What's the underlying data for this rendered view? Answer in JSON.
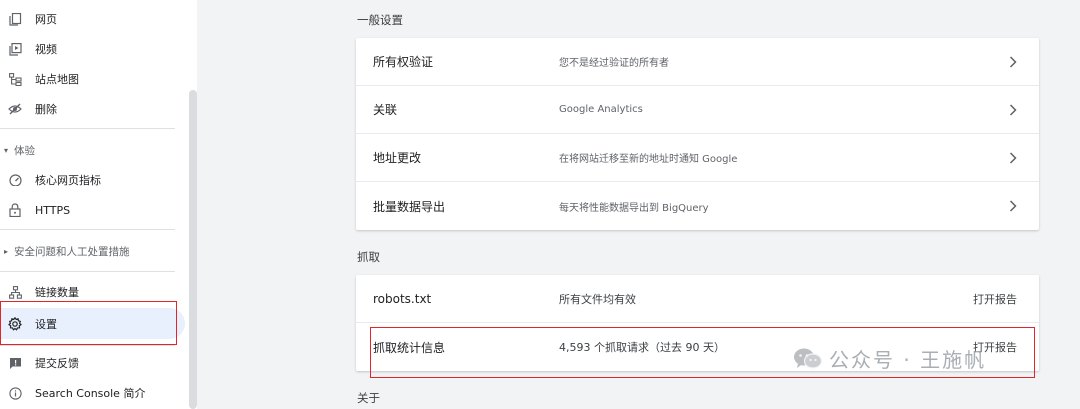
{
  "sidebar": {
    "items_top": [
      {
        "label": "网页",
        "icon": "pages-icon"
      },
      {
        "label": "视频",
        "icon": "video-icon"
      },
      {
        "label": "站点地图",
        "icon": "sitemap-icon"
      },
      {
        "label": "删除",
        "icon": "hidden-eye-icon"
      }
    ],
    "section_experience": "体验",
    "items_experience": [
      {
        "label": "核心网页指标",
        "icon": "speedometer-icon"
      },
      {
        "label": "HTTPS",
        "icon": "lock-icon"
      }
    ],
    "section_security": "安全问题和人工处置措施",
    "items_bottom": [
      {
        "label": "链接数量",
        "icon": "links-icon"
      },
      {
        "label": "设置",
        "icon": "gear-icon"
      }
    ],
    "items_footer": [
      {
        "label": "提交反馈",
        "icon": "feedback-icon"
      },
      {
        "label": "Search Console 简介",
        "icon": "info-icon"
      }
    ]
  },
  "main": {
    "general_heading": "一般设置",
    "general_rows": [
      {
        "title": "所有权验证",
        "desc": "您不是经过验证的所有者"
      },
      {
        "title": "关联",
        "desc": "Google Analytics"
      },
      {
        "title": "地址更改",
        "desc": "在将网站迁移至新的地址时通知 Google"
      },
      {
        "title": "批量数据导出",
        "desc": "每天将性能数据导出到 BigQuery"
      }
    ],
    "crawl_heading": "抓取",
    "crawl_rows": [
      {
        "title": "robots.txt",
        "desc": "所有文件均有效",
        "action": "打开报告"
      },
      {
        "title": "抓取统计信息",
        "desc": "4,593 个抓取请求（过去 90 天）",
        "action": "打开报告"
      }
    ],
    "about_heading": "关于"
  },
  "watermark": {
    "text": "公众号 · 王施帆",
    "icon": "wechat-icon"
  },
  "colors": {
    "highlight_box": "#e0252b",
    "active_bg": "#e8f0fe",
    "page_bg": "#f1f3f4"
  }
}
